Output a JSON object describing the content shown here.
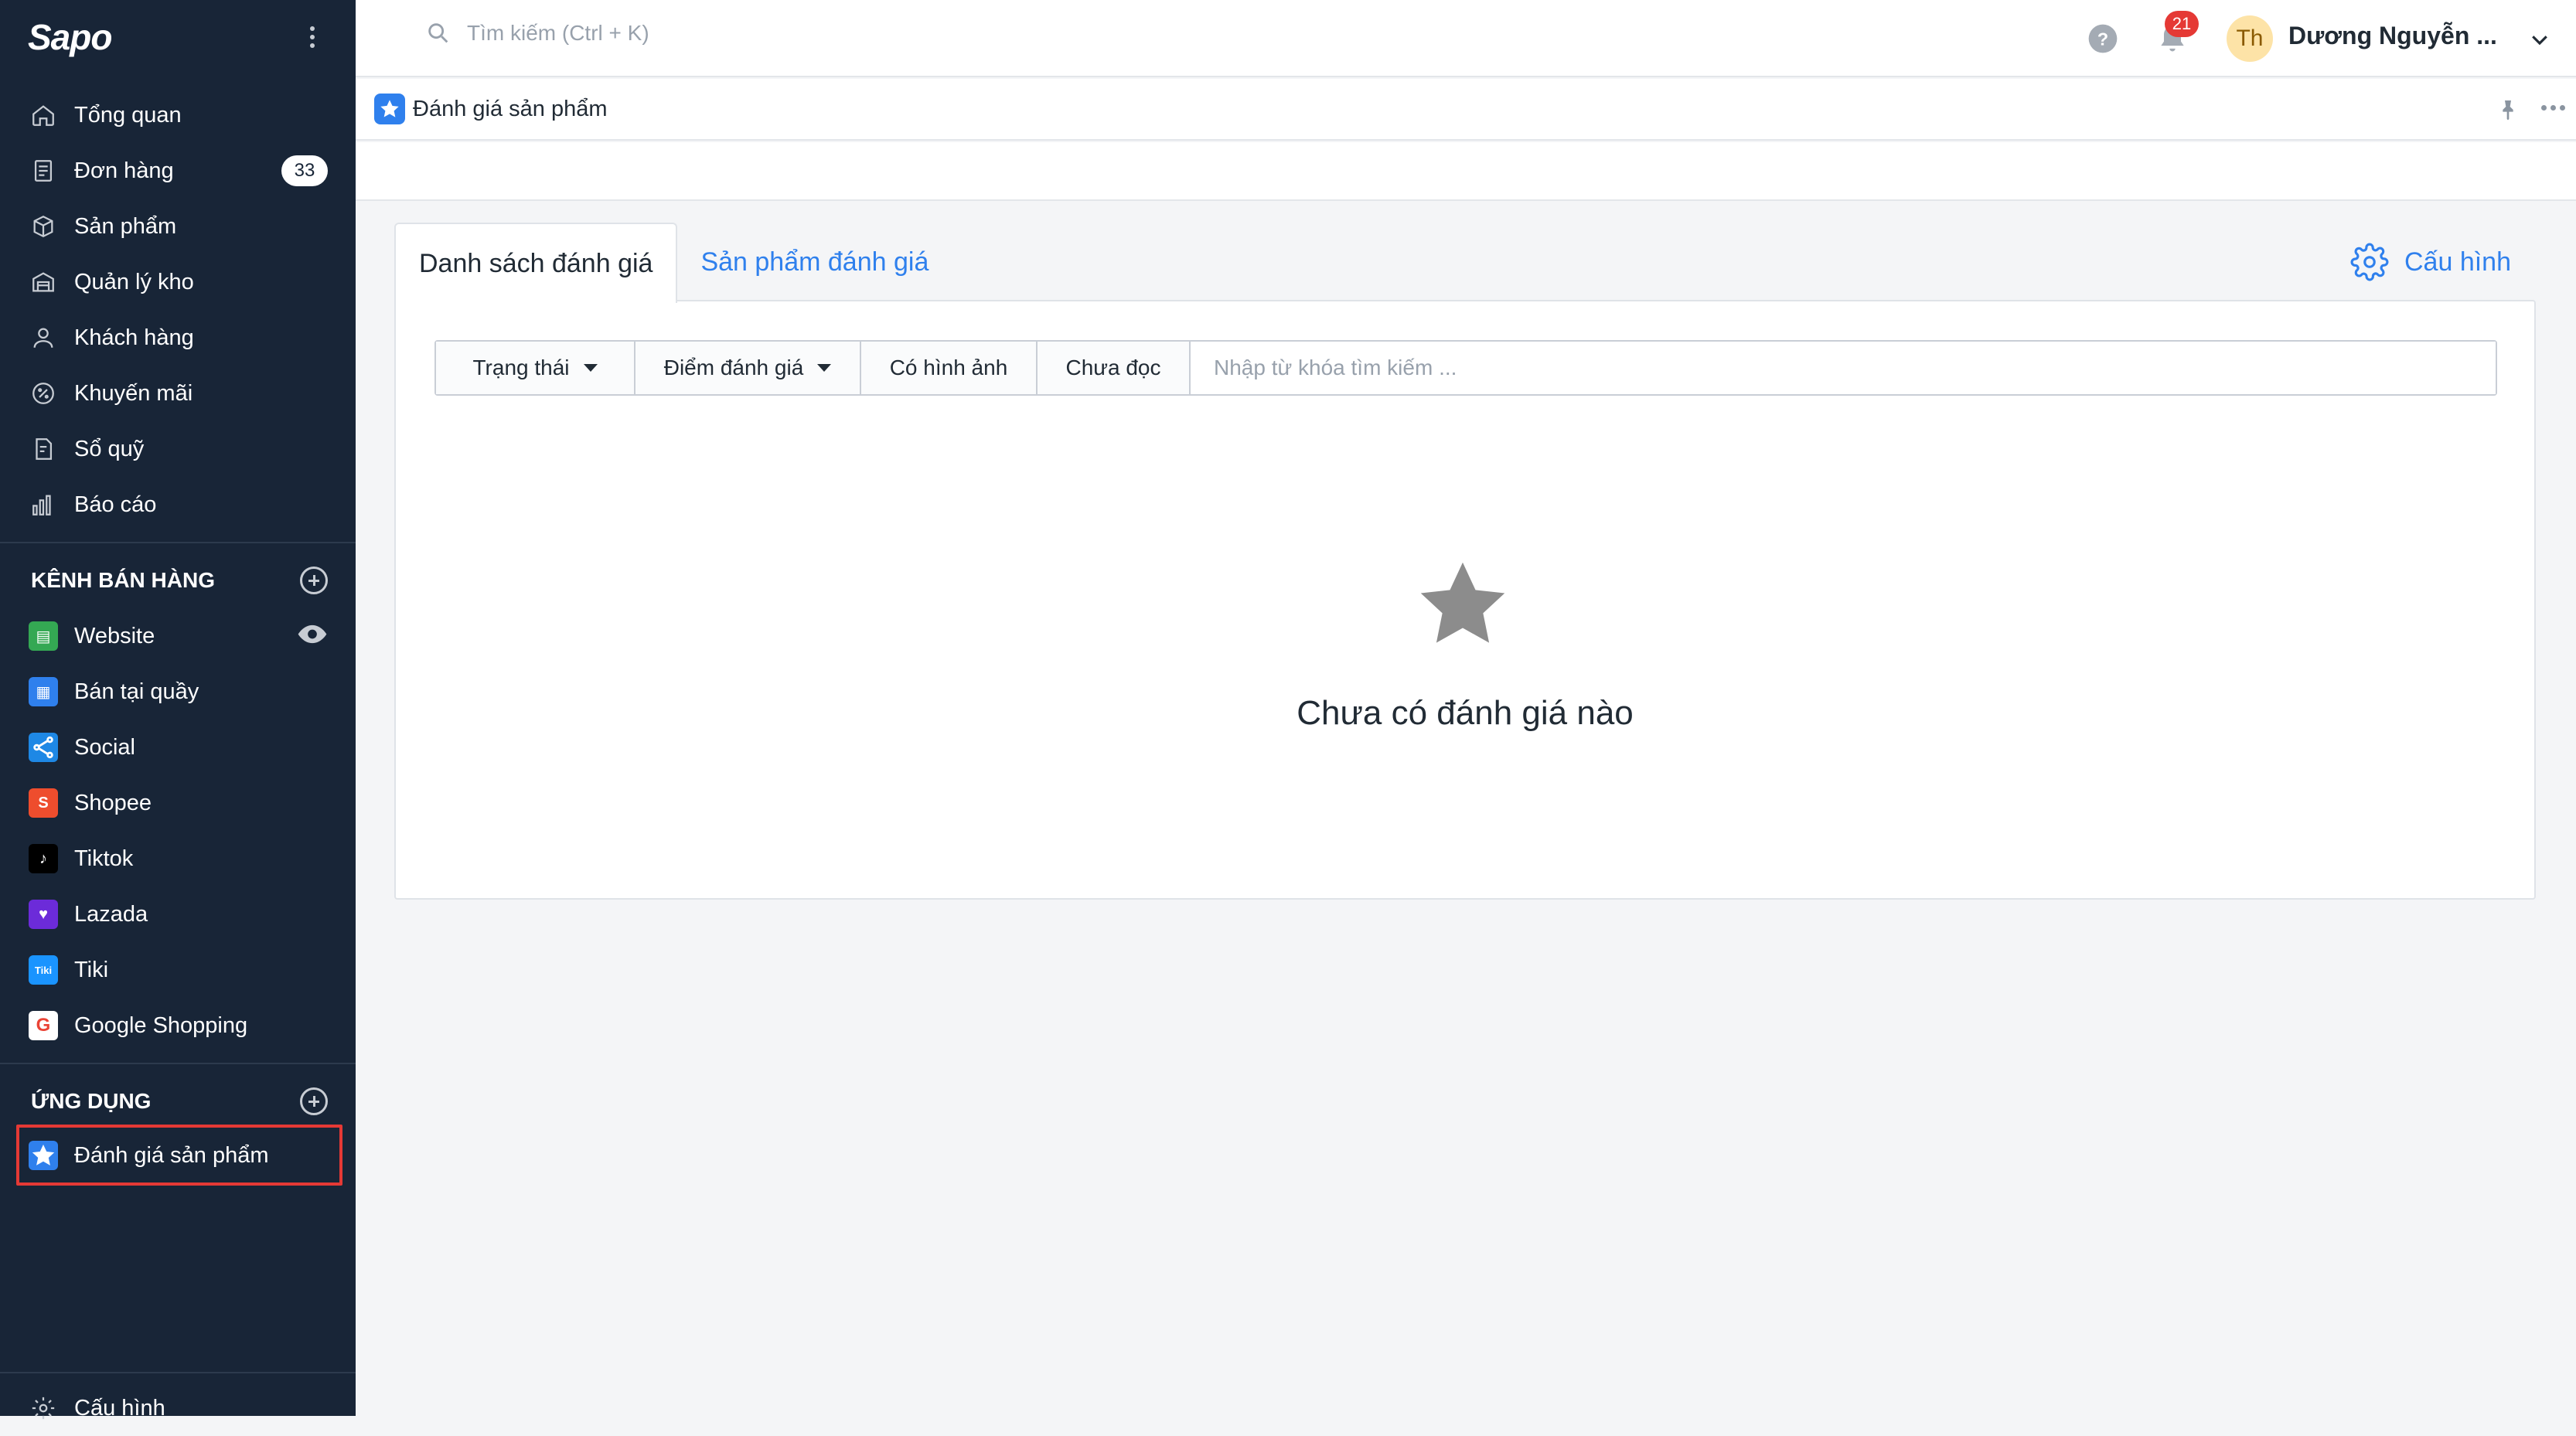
{
  "brand": {
    "logo": "Sapo"
  },
  "sidebar": {
    "main_items": [
      {
        "label": "Tổng quan",
        "icon": "home-icon"
      },
      {
        "label": "Đơn hàng",
        "icon": "order-icon",
        "badge": "33"
      },
      {
        "label": "Sản phẩm",
        "icon": "box-icon"
      },
      {
        "label": "Quản lý kho",
        "icon": "warehouse-icon"
      },
      {
        "label": "Khách hàng",
        "icon": "user-icon"
      },
      {
        "label": "Khuyến mãi",
        "icon": "discount-icon"
      },
      {
        "label": "Sổ quỹ",
        "icon": "ledger-icon"
      },
      {
        "label": "Báo cáo",
        "icon": "chart-icon"
      }
    ],
    "sales_channels_title": "KÊNH BÁN HÀNG",
    "channels": [
      {
        "label": "Website",
        "color": "#34a853",
        "glyph": "▤"
      },
      {
        "label": "Bán tại quầy",
        "color": "#2f80ed",
        "glyph": "▦"
      },
      {
        "label": "Social",
        "color": "#1e88e5",
        "glyph": "<"
      },
      {
        "label": "Shopee",
        "color": "#ee4d2d",
        "glyph": "S"
      },
      {
        "label": "Tiktok",
        "color": "#000000",
        "glyph": "♪"
      },
      {
        "label": "Lazada",
        "color": "#6c2bd9",
        "glyph": "♥"
      },
      {
        "label": "Tiki",
        "color": "#1a94ff",
        "glyph": "Tiki"
      },
      {
        "label": "Google Shopping",
        "color": "#ffffff",
        "glyph": "G"
      }
    ],
    "apps_title": "ỨNG DỤNG",
    "apps": [
      {
        "label": "Đánh giá sản phẩm"
      }
    ],
    "bottom_item": "Cấu hình"
  },
  "topbar": {
    "search_placeholder": "Tìm kiếm (Ctrl + K)",
    "notification_count": "21",
    "avatar_initials": "Th",
    "user_name": "Dương Nguyễn ..."
  },
  "breadcrumb": {
    "title": "Đánh giá sản phẩm"
  },
  "tabs": {
    "reviews": "Danh sách đánh giá",
    "products": "Sản phẩm đánh giá"
  },
  "config_label": "Cấu hình",
  "filters": {
    "status": "Trạng thái",
    "rating": "Điểm đánh giá",
    "with_images": "Có hình ảnh",
    "unread": "Chưa đọc",
    "search_placeholder": "Nhập từ khóa tìm kiếm ..."
  },
  "empty_state": {
    "message": "Chưa có đánh giá nào"
  },
  "colors": {
    "sidebar_bg": "#182537",
    "accent": "#2f80ed",
    "badge_red": "#e53935"
  }
}
